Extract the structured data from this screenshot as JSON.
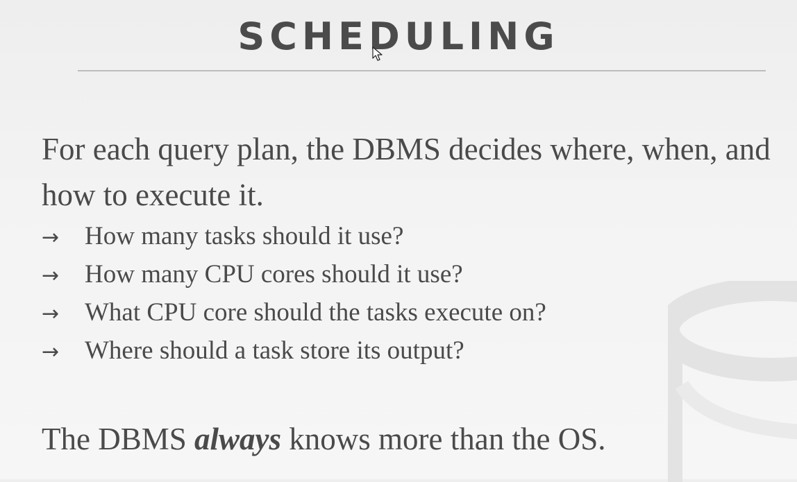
{
  "slide": {
    "title": "SCHEDULING",
    "intro": "For each query plan, the DBMS decides where, when, and how to execute it.",
    "arrow_glyph": "→",
    "bullets": [
      "How many tasks should it use?",
      "How many CPU cores should it use?",
      "What CPU core should the tasks execute on?",
      "Where should a task store its output?"
    ],
    "footer": {
      "before": "The DBMS ",
      "emphasis": "always",
      "after": " knows more than the OS."
    }
  },
  "icons": {
    "watermark": "database-cylinder-icon",
    "pointer": "mouse-cursor-icon"
  },
  "colors": {
    "text": "#4a4a4a",
    "rule": "#bdbdbd",
    "watermark": "#e4e4e4"
  }
}
